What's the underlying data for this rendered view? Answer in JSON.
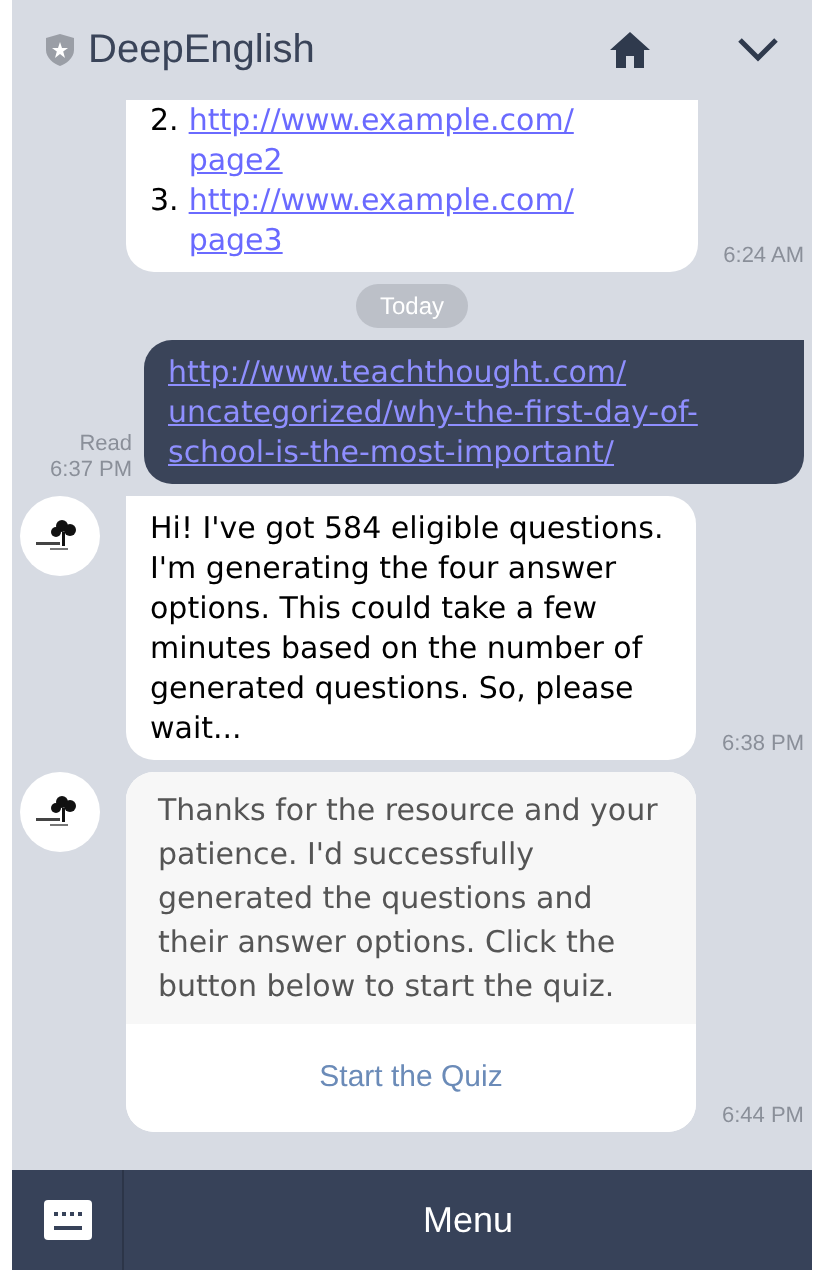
{
  "header": {
    "title": "DeepEnglish"
  },
  "messages": [
    {
      "kind": "link_list",
      "items": [
        {
          "number": "2.",
          "url": "http://www.example.com/ page2"
        },
        {
          "number": "3.",
          "url": "http://www.example.com/ page3"
        }
      ],
      "time": "6:24 AM"
    },
    {
      "kind": "date",
      "text": "Today"
    },
    {
      "kind": "sent_link",
      "url": "http://www.teachthought.com/ uncategorized/why-the-first-day-of-school-is-the-most-important/",
      "read": "Read",
      "time": "6:37 PM"
    },
    {
      "kind": "text",
      "avatar": true,
      "text": "Hi! I've got 584 eligible questions. I'm generating the four answer options. This could take a few minutes based on the number of generated questions. So, please wait...",
      "time": "6:38 PM"
    },
    {
      "kind": "card",
      "avatar": true,
      "text": "Thanks for the resource and your patience. I'd successfully generated the questions and their answer options. Click the button below to start the quiz.",
      "button": "Start the Quiz",
      "time": "6:44 PM"
    }
  ],
  "bottom_bar": {
    "label": "Menu"
  }
}
